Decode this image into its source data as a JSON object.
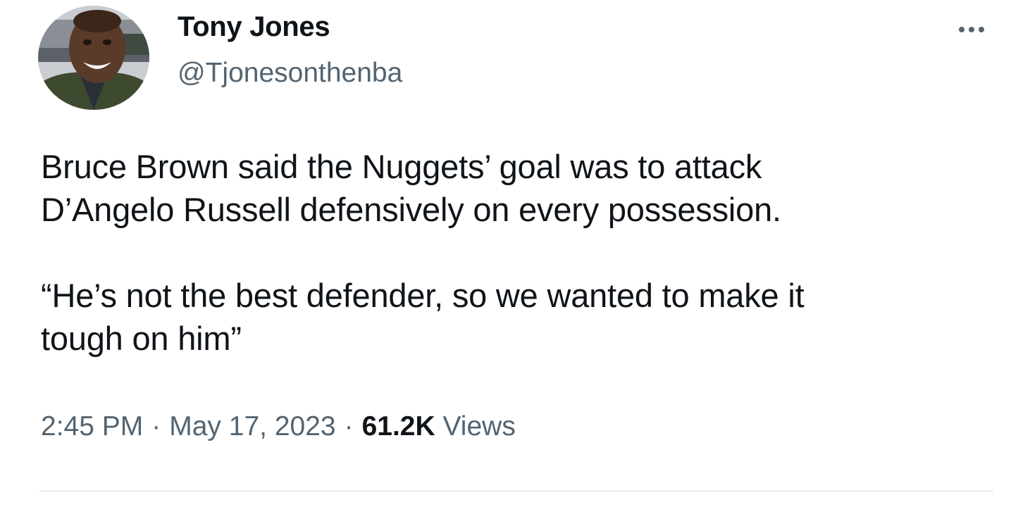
{
  "author": {
    "display_name": "Tony Jones",
    "handle": "@Tjonesonthenba"
  },
  "tweet": {
    "paragraphs": [
      "Bruce Brown said the Nuggets’ goal was to attack",
      "D’Angelo Russell defensively on every possession.",
      "“He’s not the best defender, so we wanted to make it",
      "tough on him”"
    ]
  },
  "meta": {
    "time": "2:45 PM",
    "date": "May 17, 2023",
    "separator": "·",
    "views_count": "61.2K",
    "views_label": "Views"
  },
  "icons": {
    "more": "more-horizontal-icon"
  },
  "colors": {
    "text_primary": "#0f1419",
    "text_secondary": "#536471",
    "divider": "#eff3f4"
  }
}
